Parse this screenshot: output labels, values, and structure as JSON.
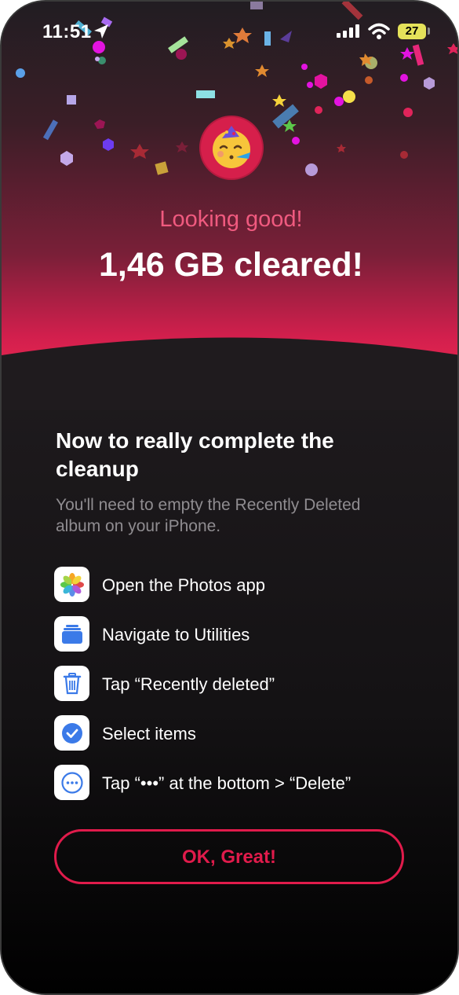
{
  "status_bar": {
    "time": "11:51",
    "battery_level": "27",
    "icons": [
      "location-arrow-icon",
      "cellular-signal-icon",
      "wifi-icon",
      "battery-icon"
    ]
  },
  "hero": {
    "emoji": "partying-face-icon",
    "subtitle": "Looking good!",
    "headline": "1,46 GB cleared!"
  },
  "instructions": {
    "title": "Now to really complete the cleanup",
    "description": "You'll need to empty the Recently Deleted album on your iPhone.",
    "steps": [
      {
        "icon": "photos-app-icon",
        "label": "Open the Photos app"
      },
      {
        "icon": "utilities-folder-icon",
        "label": "Navigate to Utilities"
      },
      {
        "icon": "trash-icon",
        "label": "Tap “Recently deleted”"
      },
      {
        "icon": "checkmark-circle-icon",
        "label": "Select items"
      },
      {
        "icon": "more-circle-icon",
        "label": "Tap “•••” at the bottom > “Delete”"
      }
    ]
  },
  "actions": {
    "ok_label": "OK, Great!"
  },
  "colors": {
    "accent": "#e01b4b",
    "subtitle_pink": "#f05a7f",
    "battery": "#e5e25a"
  }
}
